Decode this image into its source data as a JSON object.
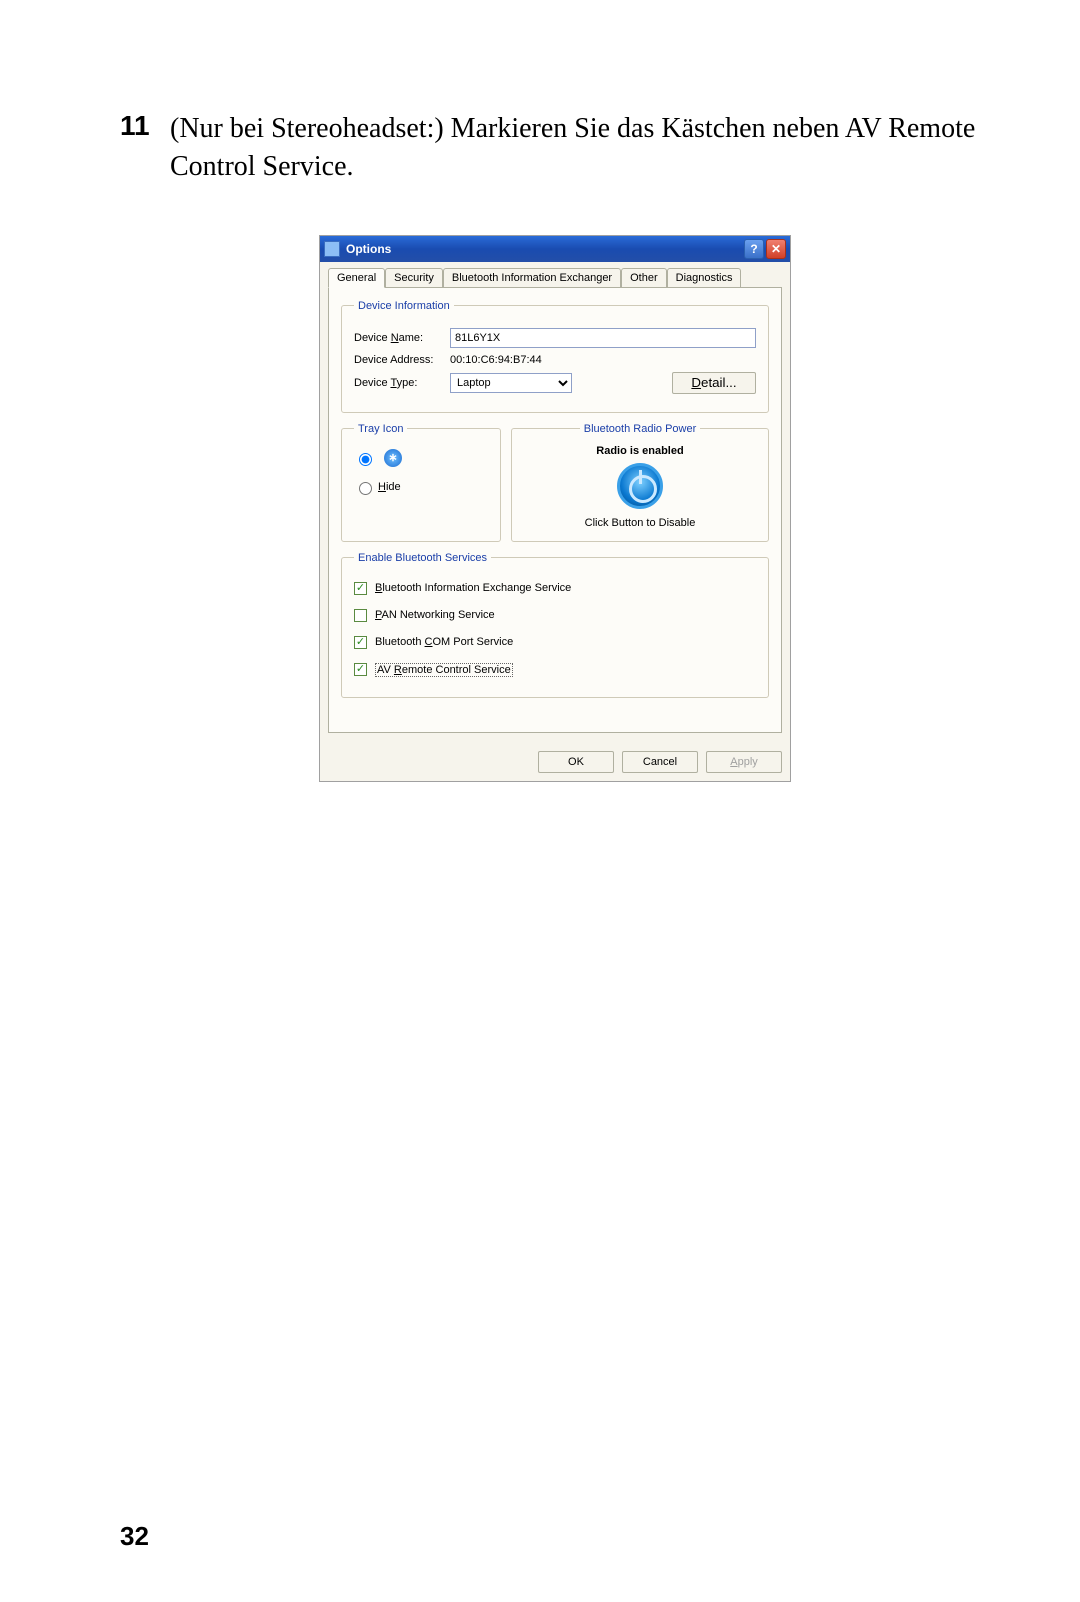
{
  "step": {
    "number": "11",
    "text_a": "(Nur bei Stereoheadset:) Markieren Sie das Kästchen neben ",
    "text_b": "AV Remote Control Service",
    "text_c": "."
  },
  "page_number": "32",
  "dialog": {
    "title": "Options",
    "tabs": [
      "General",
      "Security",
      "Bluetooth Information Exchanger",
      "Other",
      "Diagnostics"
    ],
    "device_info": {
      "legend": "Device Information",
      "name_label_pre": "Device ",
      "name_label_u": "N",
      "name_label_post": "ame:",
      "name_value": "81L6Y1X",
      "addr_label": "Device Address:",
      "addr_value": "00:10:C6:94:B7:44",
      "type_label_pre": "Device ",
      "type_label_u": "T",
      "type_label_post": "ype:",
      "type_value": "Laptop",
      "detail_pre": "",
      "detail_u": "D",
      "detail_post": "etail..."
    },
    "tray": {
      "legend": "Tray Icon",
      "hide_u": "H",
      "hide_post": "ide"
    },
    "radio": {
      "legend": "Bluetooth Radio Power",
      "enabled": "Radio is enabled",
      "click": "Click Button to Disable"
    },
    "services": {
      "legend": "Enable Bluetooth Services",
      "items": [
        {
          "checked": true,
          "u": "B",
          "post": "luetooth Information Exchange Service"
        },
        {
          "checked": false,
          "u": "P",
          "post": "AN Networking Service"
        },
        {
          "checked": true,
          "pre": "Bluetooth ",
          "u": "C",
          "post": "OM Port Service"
        },
        {
          "checked": true,
          "pre": "AV ",
          "u": "R",
          "post": "emote Control Service",
          "focus": true
        }
      ]
    },
    "buttons": {
      "ok": "OK",
      "cancel": "Cancel",
      "apply_u": "A",
      "apply_post": "pply"
    }
  }
}
